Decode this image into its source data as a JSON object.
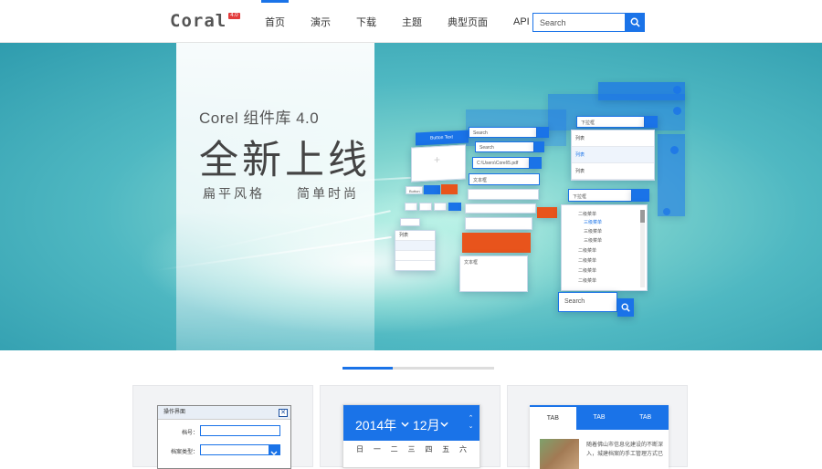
{
  "header": {
    "logo_text": "Coral",
    "logo_badge": "4.0",
    "nav": [
      "首页",
      "演示",
      "下载",
      "主题",
      "典型页面",
      "API"
    ],
    "active_nav_index": 0,
    "search_placeholder": "Search",
    "accent_color": "#1a73e8"
  },
  "hero": {
    "subtitle": "Corel 组件库 4.0",
    "title": "全新上线",
    "tagline_left": "扁平风格",
    "tagline_right": "简单时尚",
    "mock": {
      "button_text": "Button Text",
      "search1": "Search",
      "search2": "Search",
      "path": "C:\\Users\\Corel\\5.pdf",
      "text_box": "文本框",
      "text_box2": "文本框",
      "dropdown": "下拉框",
      "dropdown2": "下拉框",
      "list_items": [
        "列表",
        "列表",
        "列表"
      ],
      "tree_items": [
        "二级菜单",
        "三级菜单",
        "三级菜单",
        "三级菜单",
        "二级菜单",
        "二级菜单",
        "二级菜单",
        "二级菜单"
      ],
      "button": "Button",
      "bottom_search": "Search"
    }
  },
  "carousel": {
    "active_index": 0,
    "count": 3
  },
  "cards": {
    "form": {
      "title": "操作界面",
      "label1": "档号：",
      "label2": "档案类型："
    },
    "calendar": {
      "year": "2014年",
      "month": "12月",
      "weekdays": [
        "日",
        "一",
        "二",
        "三",
        "四",
        "五",
        "六"
      ]
    },
    "tabs": {
      "labels": [
        "TAB",
        "TAB",
        "TAB"
      ],
      "active_index": 0,
      "text": "随着佛山市信息化建设的不断深入，城建档案的手工管理方式已"
    }
  }
}
